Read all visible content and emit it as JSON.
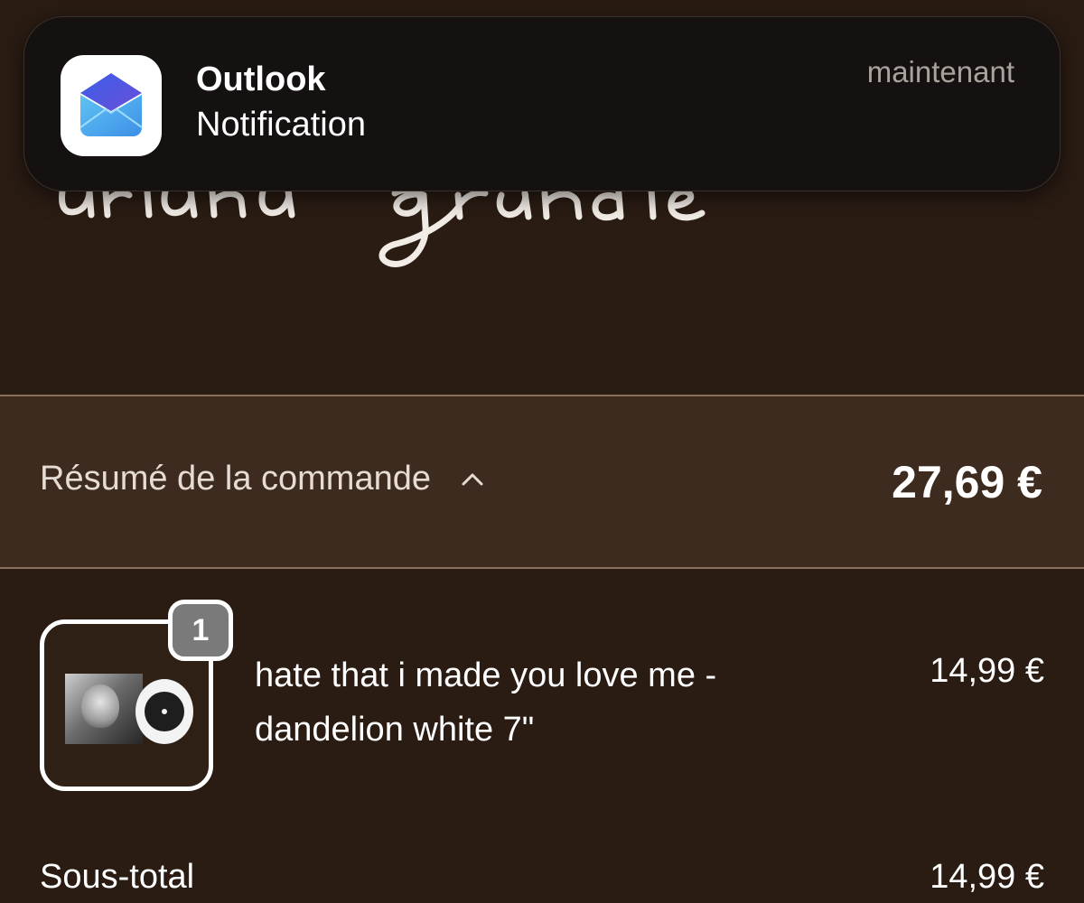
{
  "notification": {
    "app": "Outlook",
    "body": "Notification",
    "time": "maintenant",
    "icon": "outlook-envelope-icon"
  },
  "store": {
    "logo": "ariana grande"
  },
  "summary": {
    "label": "Résumé de la commande",
    "total": "27,69 €",
    "chevron": "chevron-up-icon"
  },
  "item": {
    "quantity": "1",
    "name_line1": "hate that i made you love me -",
    "name_line2": "dandelion white 7\"",
    "price": "14,99 €"
  },
  "subtotal": {
    "label": "Sous-total",
    "value": "14,99 €"
  },
  "colors": {
    "background": "#2a1c13",
    "summary_bar": "#3d2b1f",
    "notification_bg": "#141110",
    "badge": "#7a7a7a"
  }
}
